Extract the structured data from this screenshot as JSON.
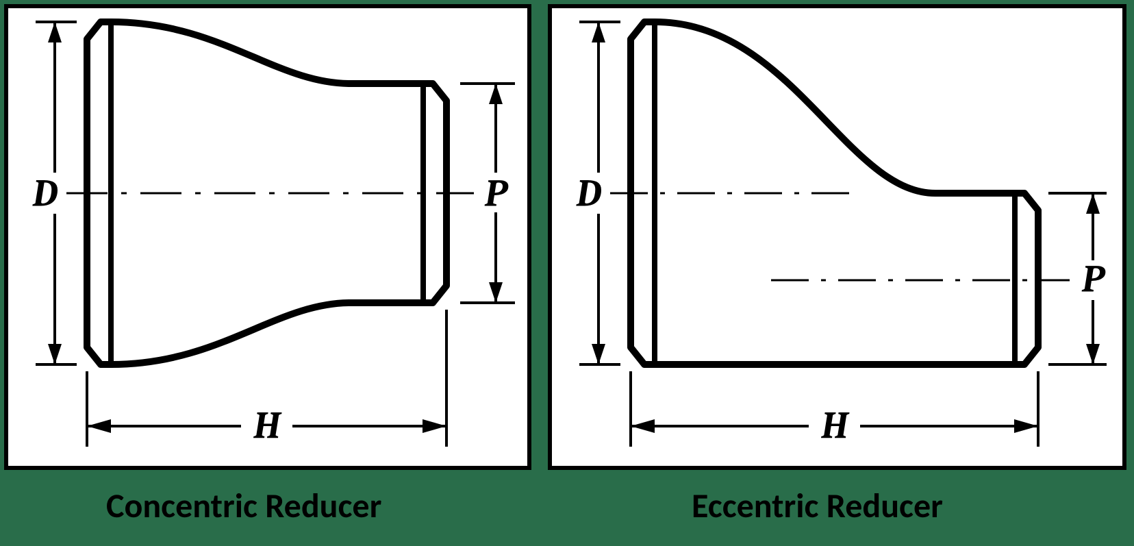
{
  "figures": {
    "left": {
      "caption": "Concentric Reducer",
      "dims": {
        "D": "D",
        "P": "P",
        "H": "H"
      }
    },
    "right": {
      "caption": "Eccentric Reducer",
      "dims": {
        "D": "D",
        "P": "P",
        "H": "H"
      }
    }
  }
}
